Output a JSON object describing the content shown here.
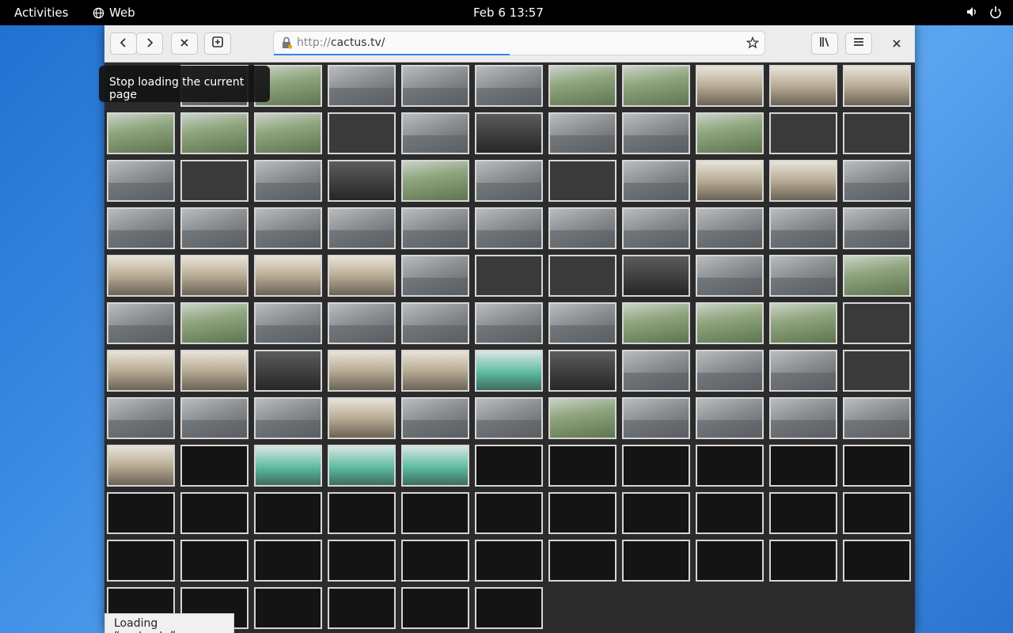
{
  "topbar": {
    "activities": "Activities",
    "app_name": "Web",
    "clock": "Feb 6  13:57"
  },
  "browser": {
    "url_scheme": "http://",
    "url_host": "cactus.tv/",
    "tooltip": "Stop loading the current page",
    "status": "Loading “cactus.tv”…",
    "page_load_progress_pct": 48
  },
  "cameras": {
    "columns": 11,
    "rows": [
      [
        "cam",
        "green",
        "cam",
        "cam",
        "cam",
        "green",
        "green",
        "indoor",
        "indoor",
        "indoor"
      ],
      [
        "green",
        "green",
        "green",
        "empty",
        "cam",
        "night",
        "cam",
        "cam",
        "green",
        "empty",
        "empty"
      ],
      [
        "cam",
        "empty",
        "cam",
        "night",
        "green",
        "cam",
        "empty",
        "cam",
        "indoor",
        "indoor",
        "cam"
      ],
      [
        "cam",
        "cam",
        "cam",
        "cam",
        "cam",
        "cam",
        "cam",
        "cam",
        "cam",
        "cam",
        "cam"
      ],
      [
        "indoor",
        "indoor",
        "indoor",
        "indoor",
        "cam",
        "empty",
        "empty",
        "night",
        "cam",
        "cam",
        "green"
      ],
      [
        "cam",
        "green",
        "cam",
        "cam",
        "cam",
        "cam",
        "cam",
        "green",
        "green",
        "green",
        "empty"
      ],
      [
        "indoor",
        "indoor",
        "night",
        "indoor",
        "indoor",
        "teal",
        "night",
        "cam",
        "cam",
        "cam",
        "empty"
      ],
      [
        "cam",
        "cam",
        "cam",
        "indoor",
        "cam",
        "cam",
        "green",
        "cam",
        "cam",
        "cam",
        "cam"
      ],
      [
        "indoor",
        "black",
        "teal",
        "teal",
        "teal",
        "black",
        "black",
        "black",
        "black",
        "black",
        "black"
      ],
      [
        "black",
        "black",
        "black",
        "black",
        "black",
        "black",
        "black",
        "black",
        "black",
        "black",
        "black"
      ],
      [
        "black",
        "black",
        "black",
        "black",
        "black",
        "black",
        "black",
        "black",
        "black",
        "black",
        "black"
      ],
      [
        "black",
        "black",
        "black",
        "black",
        "black",
        "black"
      ]
    ]
  }
}
